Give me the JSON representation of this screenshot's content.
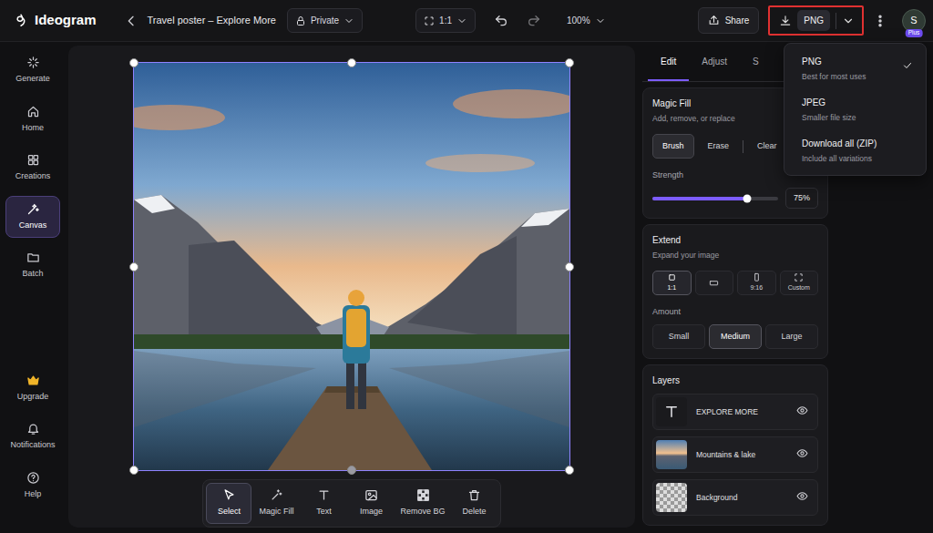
{
  "app": {
    "name": "Ideogram"
  },
  "header": {
    "title": "Travel poster – Explore More",
    "privacy": "Private",
    "aspect": "1:1",
    "zoom": "100%",
    "share": "Share",
    "download": {
      "format": "PNG",
      "highlighted": true,
      "menu_open": true
    },
    "avatar": {
      "initial": "S",
      "badge": "Plus"
    }
  },
  "sidebar": {
    "items": [
      {
        "label": "Generate",
        "selected": false
      },
      {
        "label": "Home",
        "selected": false
      },
      {
        "label": "Creations",
        "selected": false
      },
      {
        "label": "Canvas",
        "selected": true
      },
      {
        "label": "Batch",
        "selected": false
      }
    ],
    "bottom_items": [
      {
        "label": "Upgrade"
      },
      {
        "label": "Notifications"
      },
      {
        "label": "Help"
      }
    ]
  },
  "canvas": {
    "selected": true
  },
  "toolbar": [
    {
      "label": "Select",
      "selected": true
    },
    {
      "label": "Magic Fill",
      "selected": false
    },
    {
      "label": "Text",
      "selected": false
    },
    {
      "label": "Image",
      "selected": false
    },
    {
      "label": "Remove BG",
      "selected": false
    },
    {
      "label": "Delete",
      "selected": false
    }
  ],
  "panel": {
    "tabs": [
      {
        "label": "Edit",
        "selected": true
      },
      {
        "label": "Adjust",
        "selected": false
      },
      {
        "label": "S",
        "selected": false
      }
    ],
    "magic_fill": {
      "title": "Magic Fill",
      "subtitle": "Add, remove, or replace",
      "modes": [
        {
          "label": "Brush",
          "selected": true
        },
        {
          "label": "Erase",
          "selected": false
        },
        {
          "label": "Clear",
          "selected": false
        }
      ],
      "strength": {
        "label": "Strength",
        "level": 0.75,
        "reading": "75%"
      }
    },
    "extend": {
      "title": "Extend",
      "subtitle": "Expand your image",
      "ratios": [
        {
          "kind": "square",
          "label": "1:1",
          "selected": true
        },
        {
          "kind": "landscape",
          "selected": false
        },
        {
          "kind": "portrait",
          "label": "9:16",
          "selected": false
        },
        {
          "kind": "custom",
          "label": "Custom",
          "selected": false
        }
      ],
      "amount_label": "Amount",
      "amounts": [
        {
          "label": "Small",
          "selected": false
        },
        {
          "label": "Medium",
          "selected": true
        },
        {
          "label": "Large",
          "selected": false
        }
      ]
    },
    "layers": {
      "title": "Layers",
      "items": [
        {
          "name": "EXPLORE MORE",
          "kind": "text",
          "visible": true
        },
        {
          "name": "Mountains & lake",
          "kind": "image",
          "visible": true
        },
        {
          "name": "Background",
          "kind": "transparent",
          "visible": true
        }
      ]
    }
  },
  "download_menu": {
    "items": [
      {
        "label": "PNG",
        "description": "Best for most uses",
        "selected": true
      },
      {
        "label": "JPEG",
        "description": "Smaller file size",
        "selected": false
      },
      {
        "label": "Download all (ZIP)",
        "description": "Include all variations",
        "selected": false
      }
    ]
  }
}
